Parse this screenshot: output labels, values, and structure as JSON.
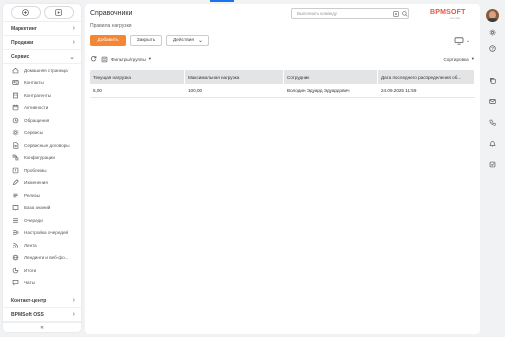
{
  "sidebar": {
    "sections": {
      "marketing": "Маркетинг",
      "sales": "Продажи",
      "service": "Сервис",
      "contact_center": "Контакт-центр",
      "bpmsoft_oss": "BPMSoft OSS"
    },
    "items": [
      {
        "label": "Домашняя страница",
        "icon": "home-icon"
      },
      {
        "label": "Контакты",
        "icon": "contact-card-icon"
      },
      {
        "label": "Контрагенты",
        "icon": "building-icon"
      },
      {
        "label": "Активности",
        "icon": "calendar-icon"
      },
      {
        "label": "Обращения",
        "icon": "appeal-icon"
      },
      {
        "label": "Сервисы",
        "icon": "gear-icon"
      },
      {
        "label": "Сервисные договоры",
        "icon": "document-icon"
      },
      {
        "label": "Конфигурации",
        "icon": "configuration-icon"
      },
      {
        "label": "Проблемы",
        "icon": "problem-icon"
      },
      {
        "label": "Изменения",
        "icon": "pencil-icon"
      },
      {
        "label": "Релизы",
        "icon": "release-icon"
      },
      {
        "label": "База знаний",
        "icon": "book-icon"
      },
      {
        "label": "Очереди",
        "icon": "queue-icon"
      },
      {
        "label": "Настройка очередей",
        "icon": "queue-settings-icon"
      },
      {
        "label": "Лента",
        "icon": "feed-icon"
      },
      {
        "label": "Лендинги и веб-фо...",
        "icon": "landing-icon"
      },
      {
        "label": "Итоги",
        "icon": "chart-icon"
      },
      {
        "label": "Чаты",
        "icon": "chat-icon"
      }
    ],
    "collapse_glyph": "«"
  },
  "header": {
    "title": "Справочники",
    "subtitle": "Правила нагрузки",
    "command_placeholder": "Выполнить команду",
    "logo": "BPMSOFT",
    "logo_sub": "low-code"
  },
  "toolbar": {
    "add_label": "Добавить",
    "close_label": "Закрыть",
    "actions_label": "Действия"
  },
  "filters": {
    "filters_label": "Фильтры/группы",
    "sort_label": "Сортировка"
  },
  "grid": {
    "columns": [
      "Текущая нагрузка",
      "Максимальная нагрузка",
      "Сотрудник",
      "Дата последнего распределения об..."
    ],
    "rows": [
      [
        "5,00",
        "100,00",
        "Володин Эдуард Эдуардович",
        "24.09.2025 11:59"
      ]
    ]
  },
  "colors": {
    "primary": "#f58634",
    "logo": "#e8563e",
    "accent": "#1a73e8"
  }
}
